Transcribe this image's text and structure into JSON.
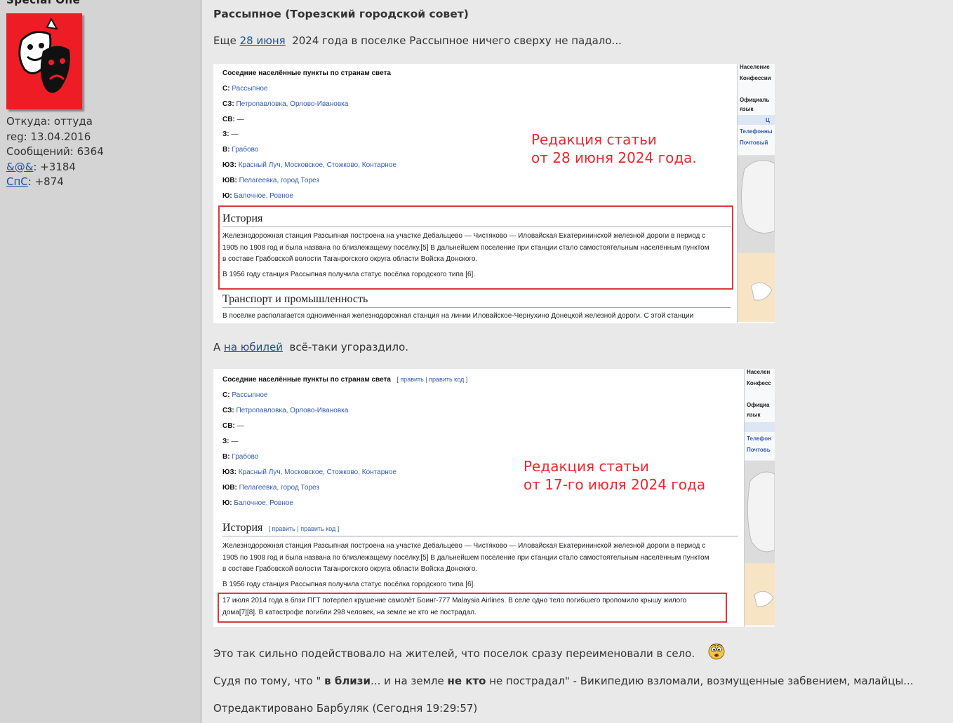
{
  "user": {
    "name": "Special One",
    "from_label": "Откуда:",
    "from_value": "оттуда",
    "reg_label": "reg:",
    "reg_value": "13.04.2016",
    "posts_label": "Сообщений:",
    "posts_value": "6364",
    "rep1_link": "&@&",
    "rep1_value": ": +3184",
    "rep2_link": "СпС",
    "rep2_value": ": +874"
  },
  "post": {
    "title": "Рассыпное (Торезский городской совет)",
    "p1_before": "Еще ",
    "p1_link": "28 июня",
    "p1_after": "  2024 года в поселке Рассыпное ничего сверху не падало...",
    "p2_before": "А ",
    "p2_link": "на юбилей",
    "p2_after": "  всё-таки угораздило.",
    "p3": "Это так сильно подействовало на жителей, что поселок сразу переименовали в село.",
    "p4_a": "Судя по тому, что \" ",
    "p4_b": "в близи",
    "p4_c": "... и на земле ",
    "p4_d": "не кто",
    "p4_e": " не пострадал\" - Википедию взломали, возмущенные забвением, малайцы...",
    "edited": "Отредактировано Барбуляк (Сегодня 19:29:57)"
  },
  "shot1": {
    "header": "Соседние населённые пункты по странам света",
    "rows": [
      {
        "k": "С:",
        "v": "Рассыпное"
      },
      {
        "k": "СЗ:",
        "v": "Петропавловка, Орлово-Ивановка"
      },
      {
        "k": "СВ:",
        "v": "—"
      },
      {
        "k": "З:",
        "v": "—"
      },
      {
        "k": "В:",
        "v": "Грабово"
      },
      {
        "k": "ЮЗ:",
        "v": "Красный Луч, Московское, Стожково, Контарное"
      },
      {
        "k": "ЮВ:",
        "v": "Пелагеевка, город Торез"
      },
      {
        "k": "Ю:",
        "v": "Балочное, Ровное"
      }
    ],
    "note1": "Редакция статьи",
    "note2": "от 28 июня 2024 года.",
    "history_title": "История",
    "history_lines": [
      "Железнодорожная станция Разсыпная построена на участке Дебальцево — Чистяково — Иловайская Екатерининской железной дороги в период с",
      "1905 по 1908 год и была названа по близлежащему посёлку.[5] В дальнейшем поселение при станции стало самостоятельным населённым пунктом",
      "в составе Грабовской волости Таганрогского округа области Войска Донского."
    ],
    "history_1956": "В 1956 году станция Рассыпная получила статус посёлка городского типа [6].",
    "transport_title": "Транспорт и промышленность",
    "transport_line": "В посёлке располагается одноимённая железнодорожная станция на линии Иловайское-Чернухино Донецкой железной дороги. С этой станции",
    "side": [
      "Население",
      "Конфессии",
      "Официаль",
      "язык",
      "Ц",
      "Телефонны",
      "Почтовый"
    ]
  },
  "shot2": {
    "header": "Соседние населённые пункты по странам света",
    "edit_links": "[ править | править код ]",
    "rows": [
      {
        "k": "С:",
        "v": "Рассыпное"
      },
      {
        "k": "СЗ:",
        "v": "Петропавловка, Орлово-Ивановка"
      },
      {
        "k": "СВ:",
        "v": "—"
      },
      {
        "k": "З:",
        "v": "—"
      },
      {
        "k": "В:",
        "v": "Грабово"
      },
      {
        "k": "ЮЗ:",
        "v": "Красный Луч, Московское, Стожково, Контарное"
      },
      {
        "k": "ЮВ:",
        "v": "Пелагеевка, город Торез"
      },
      {
        "k": "Ю:",
        "v": "Балочное, Ровное"
      }
    ],
    "note1": "Редакция статьи",
    "note2": "от 17-го июля 2024 года",
    "history_title": "История",
    "history_edit": "[ править | править код ]",
    "history_lines": [
      "Железнодорожная станция Разсыпная построена на участке Дебальцево — Чистяково — Иловайская Екатерининской железной дороги в период с",
      "1905 по 1908 год и была названа по близлежащему посёлку.[5] В дальнейшем поселение при станции стало самостоятельным населённым пунктом",
      "в составе Грабовской волости Таганрогского округа области Войска Донского."
    ],
    "history_1956": "В 1956 году станция Рассыпная получила статус посёлка городского типа [6].",
    "crash_line1": "17 июля 2014 года в блзи ПГТ потерпел крушение самолёт Боинг-777 Malaysia Airlines. В селе одно тело погибшего пропомило крышу жилого",
    "crash_line2": "дома[7][8]. В катастрофе погибли 298 человек, на земле не кто не пострадал.",
    "side": [
      "Населен",
      "Конфесс",
      "Официа",
      "язык",
      "Телефон",
      "Почтовь"
    ]
  }
}
